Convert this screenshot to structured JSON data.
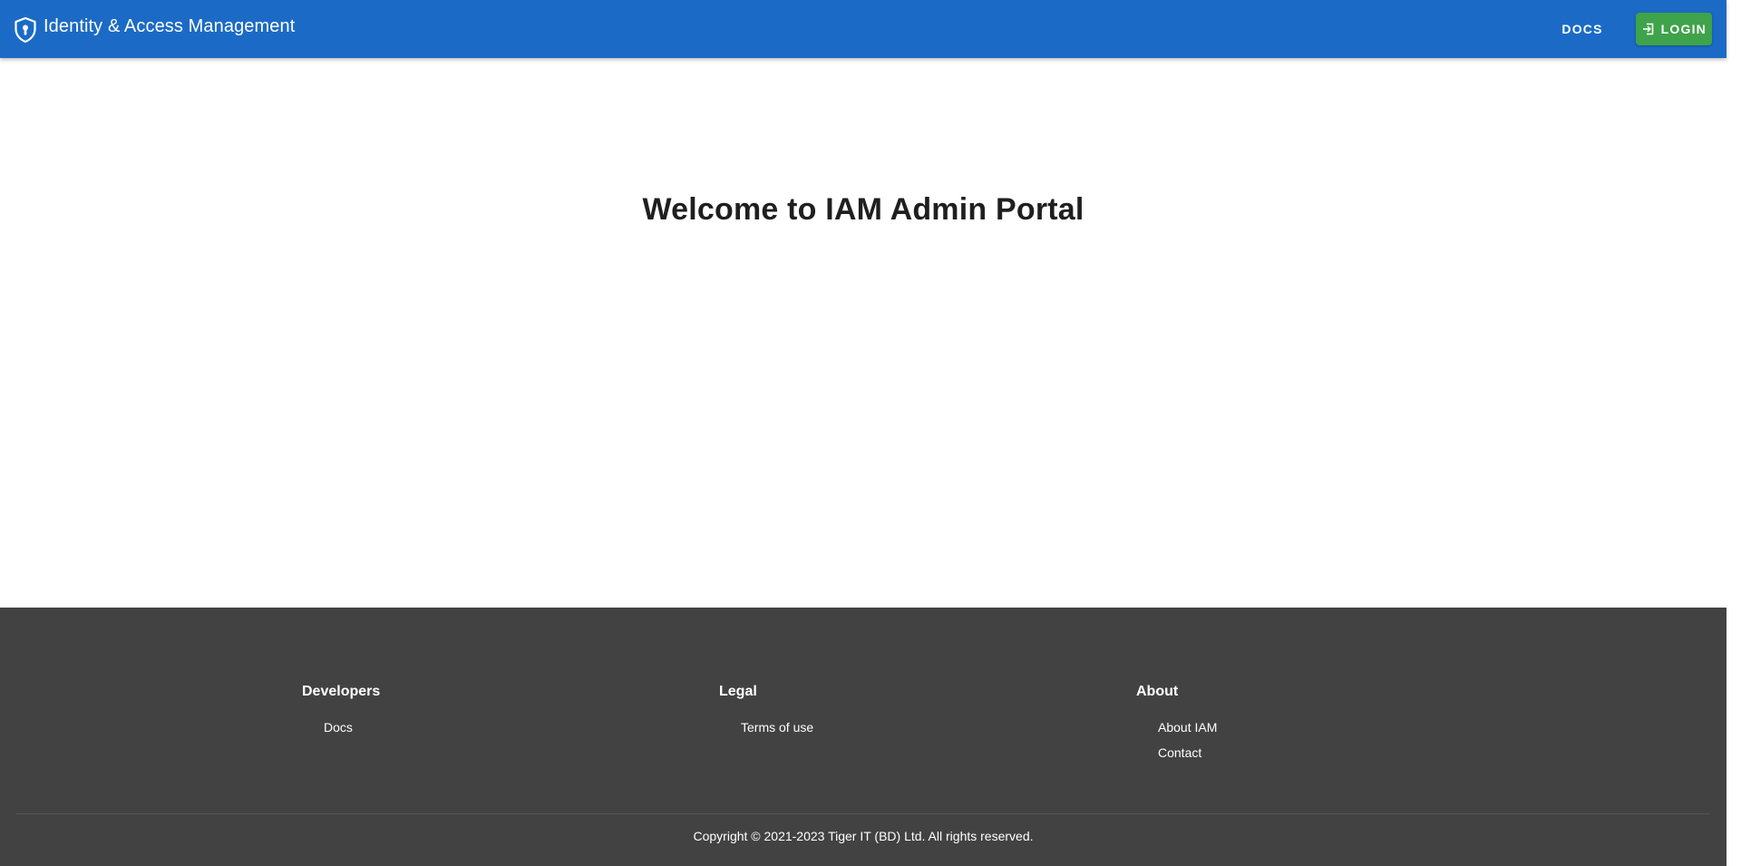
{
  "header": {
    "title": "Identity & Access Management",
    "docs_label": "DOCS",
    "login_label": "LOGIN",
    "brand_color": "#1b6bc6",
    "login_color": "#3ea34a",
    "icons": {
      "brand": "shield-keyhole-icon",
      "login": "login-icon"
    }
  },
  "main": {
    "welcome": "Welcome to IAM Admin Portal"
  },
  "footer": {
    "background": "#424242",
    "columns": [
      {
        "heading": "Developers",
        "links": [
          "Docs"
        ]
      },
      {
        "heading": "Legal",
        "links": [
          "Terms of use"
        ]
      },
      {
        "heading": "About",
        "links": [
          "About IAM",
          "Contact"
        ]
      }
    ],
    "copyright": "Copyright © 2021-2023 Tiger IT (BD) Ltd. All rights reserved."
  }
}
